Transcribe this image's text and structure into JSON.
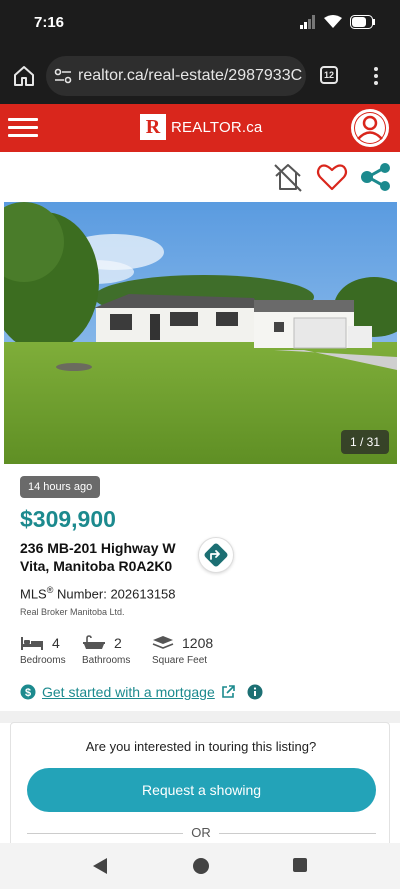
{
  "status_bar": {
    "time": "7:16"
  },
  "browser": {
    "url": "realtor.ca/real-estate/2987933C",
    "tab_count": "12"
  },
  "site": {
    "logo_mark": "R",
    "logo_text": "REALTOR.ca"
  },
  "listing": {
    "photo_counter": "1 / 31",
    "posted_badge": "14 hours ago",
    "price": "$309,900",
    "address_line1": "236 MB-201 Highway W",
    "address_line2": "Vita, Manitoba R0A2K0",
    "mls_prefix": "MLS",
    "mls_reg": "®",
    "mls_suffix": " Number: 202613158",
    "brokerage": "Real Broker Manitoba Ltd.",
    "stats": {
      "bedrooms": {
        "value": "4",
        "label": "Bedrooms"
      },
      "bathrooms": {
        "value": "2",
        "label": "Bathrooms"
      },
      "square_feet": {
        "value": "1208",
        "label": "Square Feet"
      }
    },
    "mortgage_link": "Get started with a mortgage"
  },
  "tour": {
    "question": "Are you interested in touring this listing?",
    "request_button": "Request a showing",
    "or_label": "OR"
  },
  "colors": {
    "brand_red": "#d9261c",
    "accent_teal": "#1c8a8e",
    "button_teal": "#23a3b8"
  }
}
